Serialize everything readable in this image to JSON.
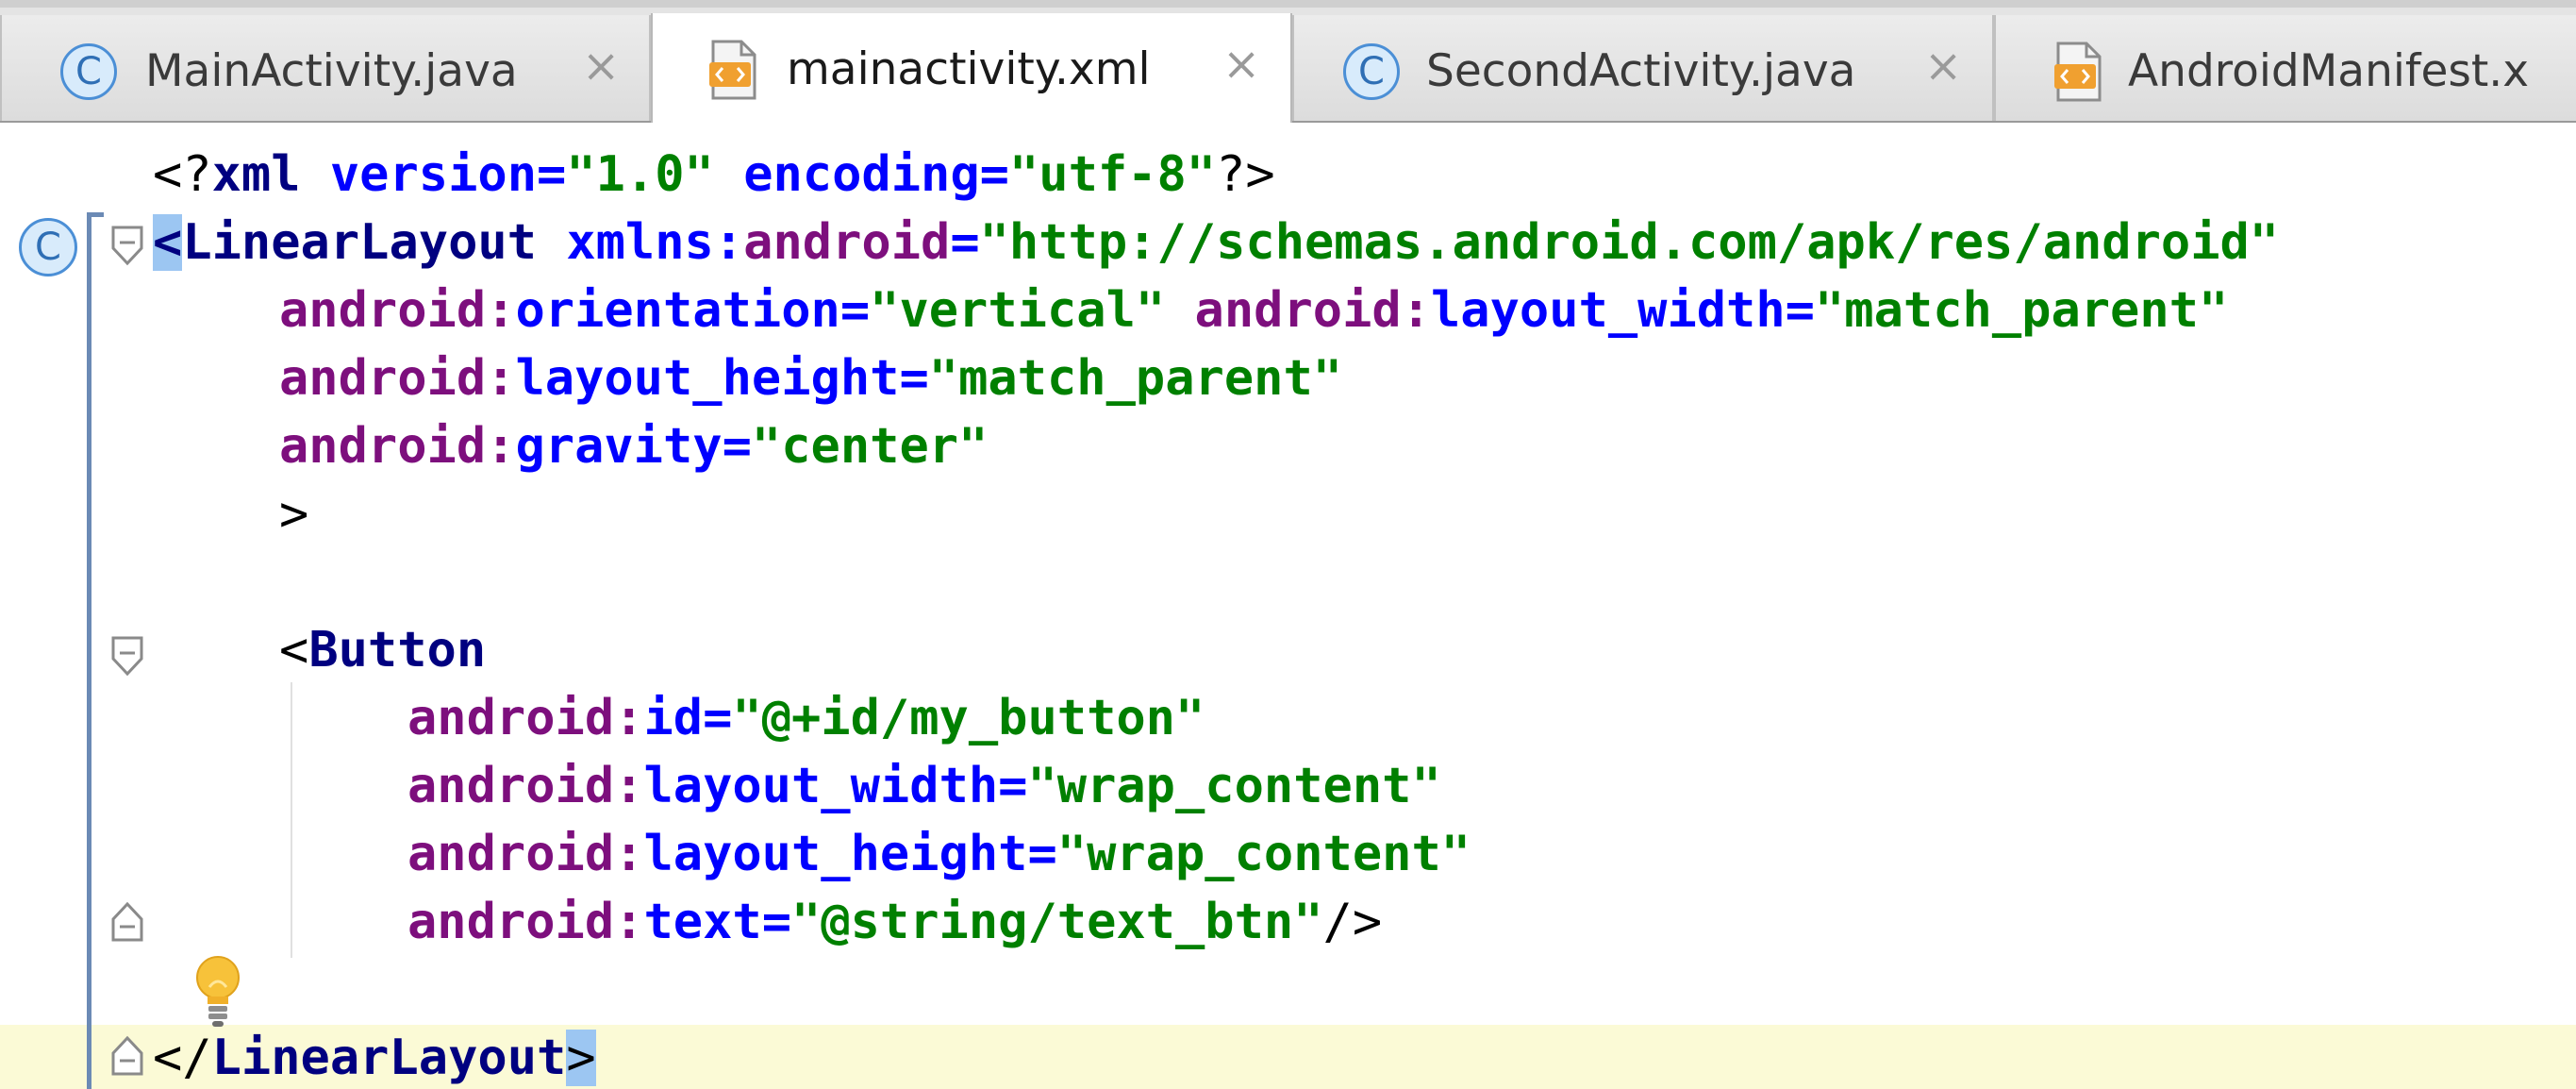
{
  "tabs": [
    {
      "icon": "class-icon",
      "icon_glyph": "C",
      "label": "MainActivity.java",
      "close": "×",
      "active": false
    },
    {
      "icon": "xml-file-icon",
      "label": "mainactivity.xml",
      "close": "×",
      "active": true
    },
    {
      "icon": "class-icon",
      "icon_glyph": "C",
      "label": "SecondActivity.java",
      "close": "×",
      "active": false
    },
    {
      "icon": "xml-file-icon",
      "label": "AndroidManifest.x",
      "active": false
    }
  ],
  "gutter": {
    "class_marker_glyph": "C"
  },
  "code": {
    "l1": {
      "open": "<?",
      "xml": "xml",
      "sp1": " ",
      "version_attr": "version",
      "eq1": "=",
      "version_val": "\"1.0\"",
      "sp2": " ",
      "encoding_attr": "encoding",
      "eq2": "=",
      "encoding_val": "\"utf-8\"",
      "close": "?>"
    },
    "l2": {
      "open": "<",
      "tag": "LinearLayout",
      "sp": " ",
      "xmlns": "xmlns:",
      "ns": "android",
      "eq": "=",
      "val": "\"http://schemas.android.com/apk/res/android\""
    },
    "l3": {
      "ns1": "android:",
      "attr1": "orientation",
      "eq1": "=",
      "val1": "\"vertical\"",
      "sp": " ",
      "ns2": "android:",
      "attr2": "layout_width",
      "eq2": "=",
      "val2": "\"match_parent\""
    },
    "l4": {
      "ns": "android:",
      "attr": "layout_height",
      "eq": "=",
      "val": "\"match_parent\""
    },
    "l5": {
      "ns": "android:",
      "attr": "gravity",
      "eq": "=",
      "val": "\"center\""
    },
    "l6": {
      "text": ">"
    },
    "l8": {
      "open": "<",
      "tag": "Button"
    },
    "l9": {
      "ns": "android:",
      "attr": "id",
      "eq": "=",
      "val": "\"@+id/my_button\""
    },
    "l10": {
      "ns": "android:",
      "attr": "layout_width",
      "eq": "=",
      "val": "\"wrap_content\""
    },
    "l11": {
      "ns": "android:",
      "attr": "layout_height",
      "eq": "=",
      "val": "\"wrap_content\""
    },
    "l12": {
      "ns": "android:",
      "attr": "text",
      "eq": "=",
      "val": "\"@string/text_btn\"",
      "close": "/>"
    },
    "l14": {
      "open": "</",
      "tag": "LinearLayout",
      "close": ">"
    }
  },
  "colors": {
    "tag": "#000080",
    "attribute_namespace": "#7d0f7d",
    "attribute_name": "#0000ff",
    "attribute_value": "#008000",
    "current_line": "#fbfad6",
    "brace_match": "#9cc6f2"
  }
}
